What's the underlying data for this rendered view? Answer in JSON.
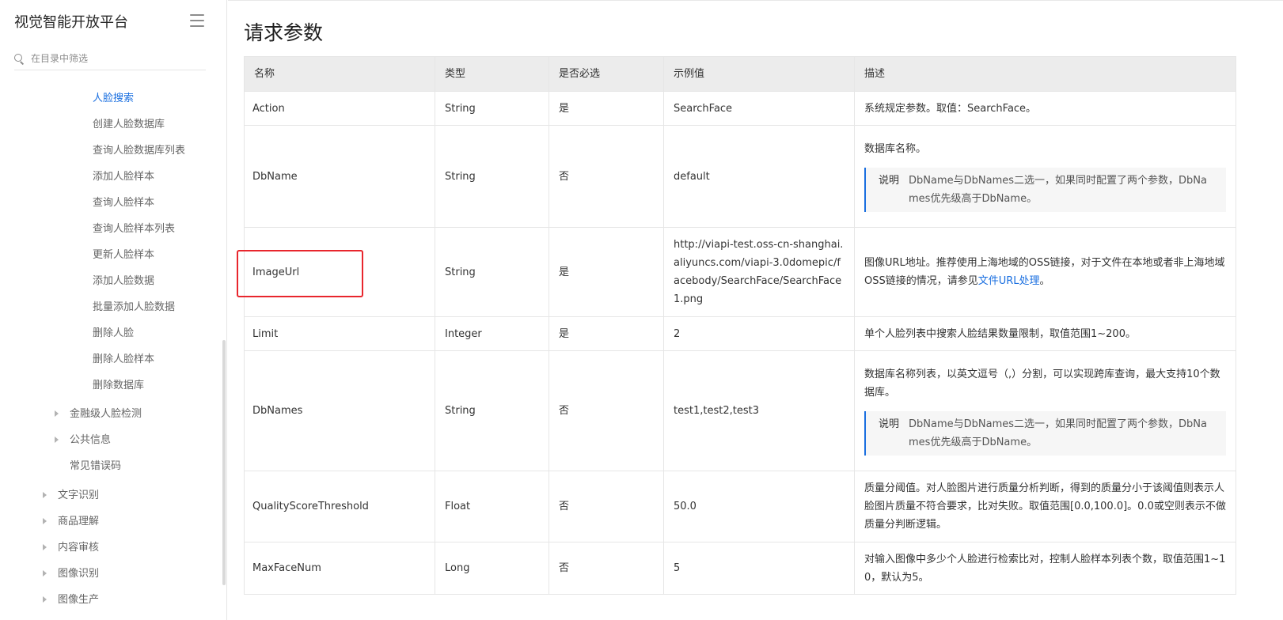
{
  "sidebar": {
    "title": "视觉智能开放平台",
    "search_placeholder": "在目录中筛选",
    "items": [
      {
        "label": "人脸搜索"
      },
      {
        "label": "创建人脸数据库"
      },
      {
        "label": "查询人脸数据库列表"
      },
      {
        "label": "添加人脸样本"
      },
      {
        "label": "查询人脸样本"
      },
      {
        "label": "查询人脸样本列表"
      },
      {
        "label": "更新人脸样本"
      },
      {
        "label": "添加人脸数据"
      },
      {
        "label": "批量添加人脸数据"
      },
      {
        "label": "删除人脸"
      },
      {
        "label": "删除人脸样本"
      },
      {
        "label": "删除数据库"
      },
      {
        "label": "金融级人脸检测"
      },
      {
        "label": "公共信息"
      },
      {
        "label": "常见错误码"
      },
      {
        "label": "文字识别"
      },
      {
        "label": "商品理解"
      },
      {
        "label": "内容审核"
      },
      {
        "label": "图像识别"
      },
      {
        "label": "图像生产"
      }
    ]
  },
  "content": {
    "section_title": "请求参数",
    "table": {
      "headers": [
        "名称",
        "类型",
        "是否必选",
        "示例值",
        "描述"
      ],
      "rows": [
        {
          "name": "Action",
          "type": "String",
          "required": "是",
          "example": "SearchFace",
          "desc": "系统规定参数。取值：SearchFace。"
        },
        {
          "name": "DbName",
          "type": "String",
          "required": "否",
          "example": "default",
          "desc": "数据库名称。",
          "note_label": "说明",
          "note": "DbName与DbNames二选一，如果同时配置了两个参数，DbNames优先级高于DbName。"
        },
        {
          "name": "ImageUrl",
          "type": "String",
          "required": "是",
          "example": "http://viapi-test.oss-cn-shanghai.aliyuncs.com/viapi-3.0domepic/facebody/SearchFace/SearchFace1.png",
          "desc": "图像URL地址。推荐使用上海地域的OSS链接，对于文件在本地或者非上海地域OSS链接的情况，请参见",
          "desc_link": "文件URL处理",
          "desc_suffix": "。"
        },
        {
          "name": "Limit",
          "type": "Integer",
          "required": "是",
          "example": "2",
          "desc": "单个人脸列表中搜索人脸结果数量限制，取值范围1~200。"
        },
        {
          "name": "DbNames",
          "type": "String",
          "required": "否",
          "example": "test1,test2,test3",
          "desc": "数据库名称列表，以英文逗号（,）分割，可以实现跨库查询，最大支持10个数据库。",
          "note_label": "说明",
          "note": "DbName与DbNames二选一，如果同时配置了两个参数，DbNames优先级高于DbName。"
        },
        {
          "name": "QualityScoreThreshold",
          "type": "Float",
          "required": "否",
          "example": "50.0",
          "desc": "质量分阈值。对人脸图片进行质量分析判断，得到的质量分小于该阈值则表示人脸图片质量不符合要求，比对失败。取值范围[0.0,100.0]。0.0或空则表示不做质量分判断逻辑。"
        },
        {
          "name": "MaxFaceNum",
          "type": "Long",
          "required": "否",
          "example": "5",
          "desc": "对输入图像中多少个人脸进行检索比对，控制人脸样本列表个数，取值范围1~10，默认为5。"
        }
      ]
    }
  },
  "colors": {
    "accent": "#1a6fe0",
    "highlight": "#e8262d",
    "header_bg": "#ececec"
  }
}
